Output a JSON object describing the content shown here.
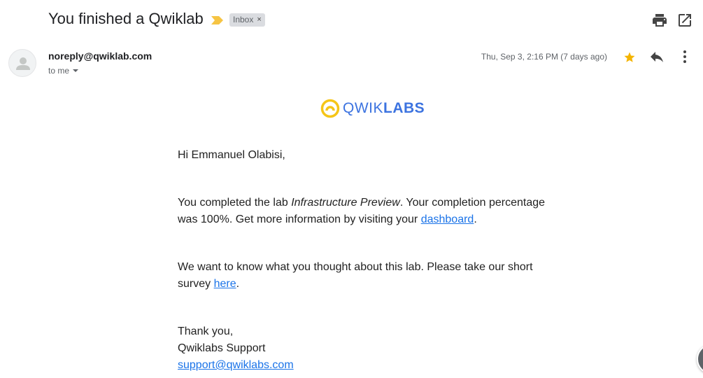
{
  "subject": "You finished a Qwiklab",
  "label": "Inbox",
  "label_close": "×",
  "header_icons": [
    "print-icon",
    "open-in-new-window-icon"
  ],
  "sender": {
    "email": "noreply@qwiklab.com",
    "to_me": "to me",
    "date": "Thu, Sep 3, 2:16 PM (7 days ago)",
    "starred": true
  },
  "colors": {
    "importance": "#f6c443",
    "star": "#f4b400",
    "logo_yellow": "#f5c518",
    "logo_blue": "#3c73e0",
    "link": "#1a73e8"
  },
  "logo": {
    "light": "QWIK",
    "bold": "LABS"
  },
  "body": {
    "greeting": "Hi Emmanuel Olabisi,",
    "p1_part1": "You completed the lab ",
    "p1_lab": "Infrastructure Preview",
    "p1_part2": ". Your completion percentage was 100%. Get more information by visiting your ",
    "p1_link": "dashboard",
    "p1_end": ".",
    "p2_part1": "We want to know what you thought about this lab. Please take our short survey ",
    "p2_link": "here",
    "p2_end": ".",
    "thanks": "Thank you,",
    "team": "Qwiklabs Support",
    "support_email": "support@qwiklabs.com"
  }
}
